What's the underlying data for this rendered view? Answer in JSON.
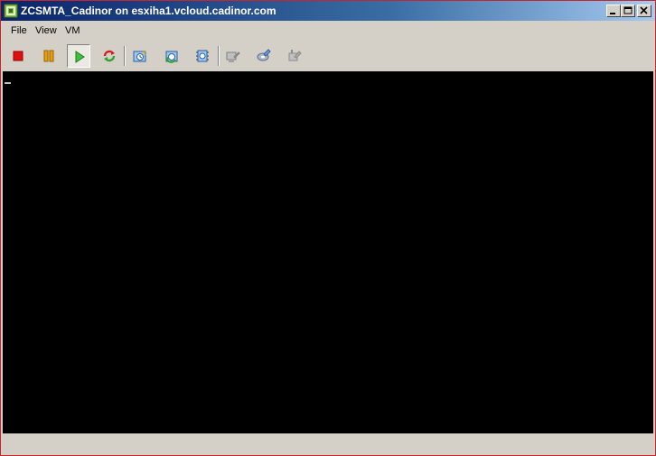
{
  "window": {
    "title": "ZCSMTA_Cadinor on esxiha1.vcloud.cadinor.com",
    "icon": "vmware-vm-icon",
    "controls": [
      "minimize-icon",
      "maximize-icon",
      "close-icon"
    ]
  },
  "menu": {
    "items": [
      {
        "label": "File"
      },
      {
        "label": "View"
      },
      {
        "label": "VM"
      }
    ]
  },
  "toolbar": {
    "buttons": [
      {
        "icon": "stop-icon",
        "color": "#e01010",
        "state": "enabled"
      },
      {
        "icon": "pause-icon",
        "color": "#e8a000",
        "state": "enabled"
      },
      {
        "icon": "play-icon",
        "color": "#30b030",
        "state": "pressed"
      },
      {
        "icon": "reset-icon",
        "color": "#d02020",
        "state": "enabled"
      },
      {
        "icon": "take-snapshot-icon",
        "state": "enabled"
      },
      {
        "icon": "revert-snapshot-icon",
        "state": "enabled"
      },
      {
        "icon": "snapshot-manager-icon",
        "state": "enabled"
      },
      {
        "icon": "vm-settings-icon",
        "state": "disabled"
      },
      {
        "icon": "connect-device-icon",
        "state": "enabled"
      },
      {
        "icon": "edit-settings-icon",
        "state": "disabled"
      }
    ]
  },
  "console": {
    "background": "#000000",
    "cursor": "_"
  },
  "colors": {
    "chrome": "#d4d0c8",
    "title_start": "#0a246a",
    "title_end": "#a6caf0",
    "window_border": "#c8242c"
  }
}
